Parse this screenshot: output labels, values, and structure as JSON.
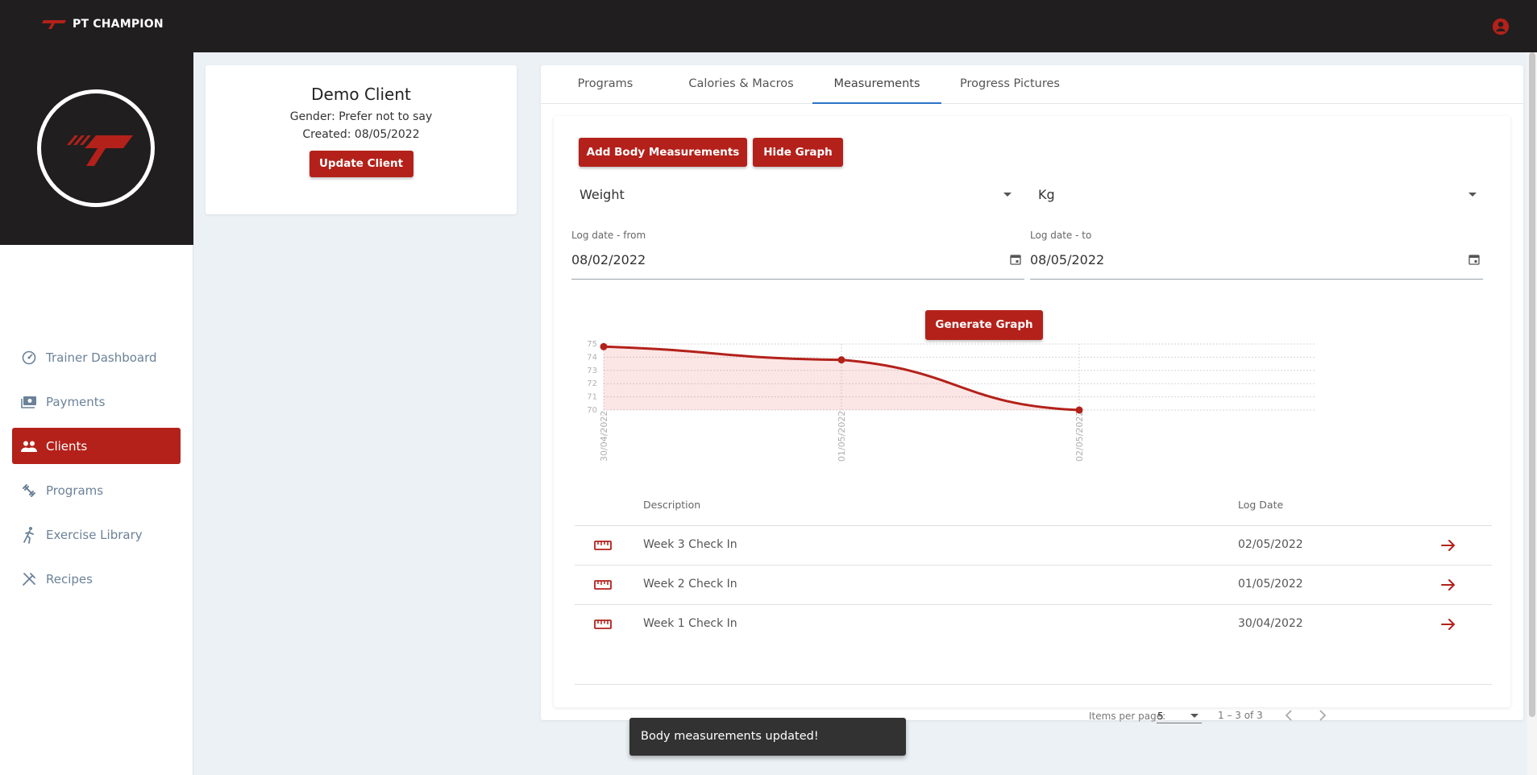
{
  "app": {
    "brand": "PT CHAMPION"
  },
  "colors": {
    "accent": "#b3211a",
    "topbar": "#201e1f",
    "tab_indicator": "#2c74c9"
  },
  "sidebar": {
    "items": [
      {
        "label": "Trainer Dashboard",
        "icon": "dashboard-icon",
        "active": false
      },
      {
        "label": "Payments",
        "icon": "payments-icon",
        "active": false
      },
      {
        "label": "Clients",
        "icon": "clients-icon",
        "active": true
      },
      {
        "label": "Programs",
        "icon": "dumbbell-icon",
        "active": false
      },
      {
        "label": "Exercise Library",
        "icon": "running-icon",
        "active": false
      },
      {
        "label": "Recipes",
        "icon": "utensils-icon",
        "active": false
      }
    ]
  },
  "client": {
    "name": "Demo Client",
    "gender": "Gender: Prefer not to say",
    "created": "Created: 08/05/2022",
    "update_label": "Update Client"
  },
  "tabs": [
    {
      "label": "Programs",
      "active": false
    },
    {
      "label": "Calories & Macros",
      "active": false
    },
    {
      "label": "Measurements",
      "active": true
    },
    {
      "label": "Progress Pictures",
      "active": false
    }
  ],
  "measurements": {
    "add_label": "Add Body Measurements",
    "hide_label": "Hide Graph",
    "metric": "Weight",
    "unit": "Kg",
    "from_label": "Log date - from",
    "from_value": "08/02/2022",
    "to_label": "Log date - to",
    "to_value": "08/05/2022",
    "generate_label": "Generate Graph"
  },
  "chart_data": {
    "type": "area",
    "x": [
      "30/04/2022",
      "01/05/2022",
      "02/05/2022"
    ],
    "values": [
      74.8,
      73.8,
      70
    ],
    "ylim": [
      70,
      75
    ],
    "yticks": [
      70,
      71,
      72,
      73,
      74,
      75
    ],
    "title": "",
    "xlabel": "",
    "ylabel": "",
    "grid": true
  },
  "table": {
    "headers": {
      "description": "Description",
      "log_date": "Log Date"
    },
    "rows": [
      {
        "description": "Week 3 Check In",
        "date": "02/05/2022"
      },
      {
        "description": "Week 2 Check In",
        "date": "01/05/2022"
      },
      {
        "description": "Week 1 Check In",
        "date": "30/04/2022"
      }
    ]
  },
  "paginator": {
    "items_label": "Items per page:",
    "page_size": "5",
    "range": "1 – 3 of 3"
  },
  "snackbar": {
    "message": "Body measurements updated!"
  }
}
